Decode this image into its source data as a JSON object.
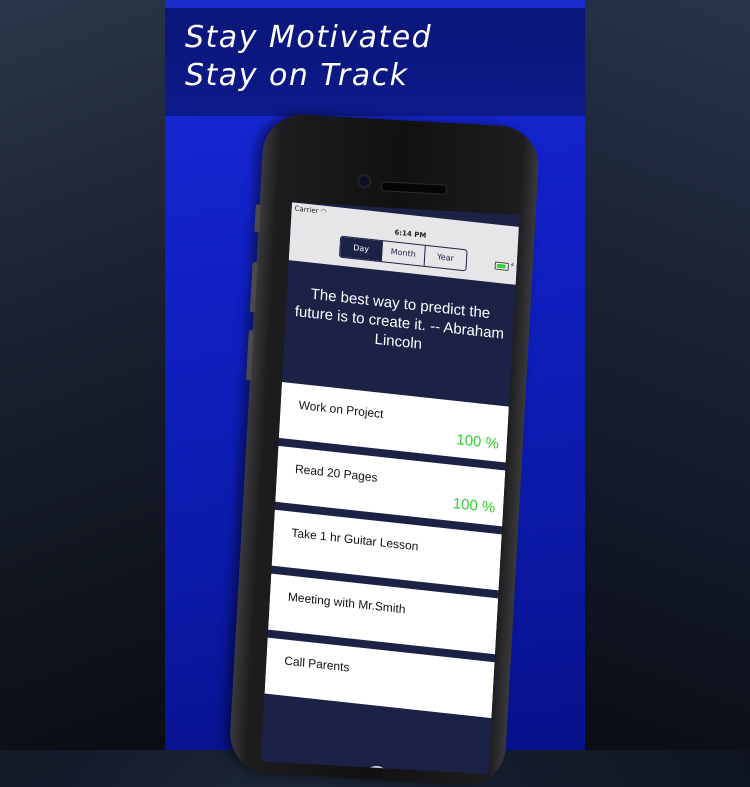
{
  "promo": {
    "headline_line1": "Stay Motivated",
    "headline_line2": "Stay on Track"
  },
  "status_bar": {
    "carrier": "Carrier",
    "time": "6:14 PM",
    "wifi_icon": "wifi-icon",
    "battery_icon": "battery-icon"
  },
  "segmented_control": {
    "options": [
      "Day",
      "Month",
      "Year"
    ],
    "selected": "Day"
  },
  "quote": {
    "text": "The best way to predict the future is to create it. -- Abraham Lincoln"
  },
  "tasks": [
    {
      "label": "Work on Project",
      "progress": "100 %"
    },
    {
      "label": "Read 20 Pages",
      "progress": "100 %"
    },
    {
      "label": "Take 1 hr Guitar Lesson",
      "progress": ""
    },
    {
      "label": "Meeting with Mr.Smith",
      "progress": ""
    },
    {
      "label": "Call Parents",
      "progress": ""
    }
  ],
  "colors": {
    "panel_blue": "#1020c4",
    "screen_navy": "#1c2146",
    "progress_green": "#2fd22f"
  }
}
